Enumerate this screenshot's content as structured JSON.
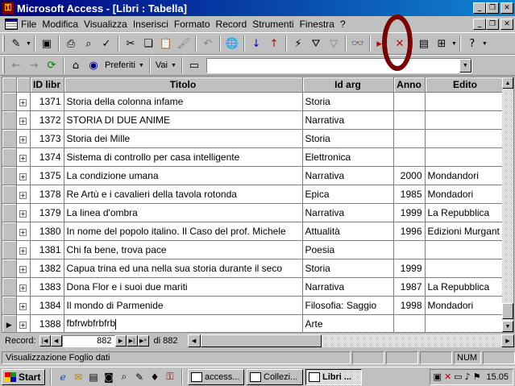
{
  "window": {
    "title": "Microsoft Access - [Libri : Tabella]"
  },
  "menu": [
    "File",
    "Modifica",
    "Visualizza",
    "Inserisci",
    "Formato",
    "Record",
    "Strumenti",
    "Finestra",
    "?"
  ],
  "web_toolbar": {
    "favorites_label": "Preferiti",
    "go_label": "Vai",
    "address_value": ""
  },
  "table": {
    "columns": [
      "ID libr",
      "Titolo",
      "Id arg",
      "Anno",
      "Edito"
    ],
    "rows": [
      {
        "id": "1371",
        "titolo": "Storia della colonna infame",
        "arg": "Storia",
        "anno": "",
        "editore": ""
      },
      {
        "id": "1372",
        "titolo": "STORIA DI DUE ANIME",
        "arg": "Narrativa",
        "anno": "",
        "editore": ""
      },
      {
        "id": "1373",
        "titolo": "Storia dei Mille",
        "arg": "Storia",
        "anno": "",
        "editore": ""
      },
      {
        "id": "1374",
        "titolo": "Sistema di controllo per casa intelligente",
        "arg": "Elettronica",
        "anno": "",
        "editore": ""
      },
      {
        "id": "1375",
        "titolo": "La condizione umana",
        "arg": "Narrativa",
        "anno": "2000",
        "editore": "Mondandori"
      },
      {
        "id": "1378",
        "titolo": "Re Artù e i cavalieri della tavola rotonda",
        "arg": "Epica",
        "anno": "1985",
        "editore": "Mondadori"
      },
      {
        "id": "1379",
        "titolo": "La linea d'ombra",
        "arg": "Narrativa",
        "anno": "1999",
        "editore": "La Repubblica"
      },
      {
        "id": "1380",
        "titolo": "In nome del popolo italino. Il Caso del prof. Michele",
        "arg": "Attualità",
        "anno": "1996",
        "editore": "Edizioni Murgant"
      },
      {
        "id": "1381",
        "titolo": "Chi fa bene, trova pace",
        "arg": "Poesia",
        "anno": "",
        "editore": ""
      },
      {
        "id": "1382",
        "titolo": "Capua trina ed una nella sua storia durante il seco",
        "arg": "Storia",
        "anno": "1999",
        "editore": ""
      },
      {
        "id": "1383",
        "titolo": "Dona Flor e i suoi due mariti",
        "arg": "Narrativa",
        "anno": "1987",
        "editore": "La Repubblica"
      },
      {
        "id": "1384",
        "titolo": "Il mondo di Parmenide",
        "arg": "Filosofia: Saggio",
        "anno": "1998",
        "editore": "Mondadori"
      },
      {
        "id": "1388",
        "titolo": "fbfrwbfrbfrb",
        "arg": "Arte",
        "anno": "",
        "editore": ""
      }
    ]
  },
  "navigation": {
    "record_label": "Record:",
    "current": "882",
    "of_total": "di 882"
  },
  "status": {
    "message": "Visualizzazione Foglio dati",
    "num": "NUM"
  },
  "taskbar": {
    "start_label": "Start",
    "tasks": [
      "access...",
      "Collezi...",
      "Libri ..."
    ],
    "clock": "15.05"
  }
}
